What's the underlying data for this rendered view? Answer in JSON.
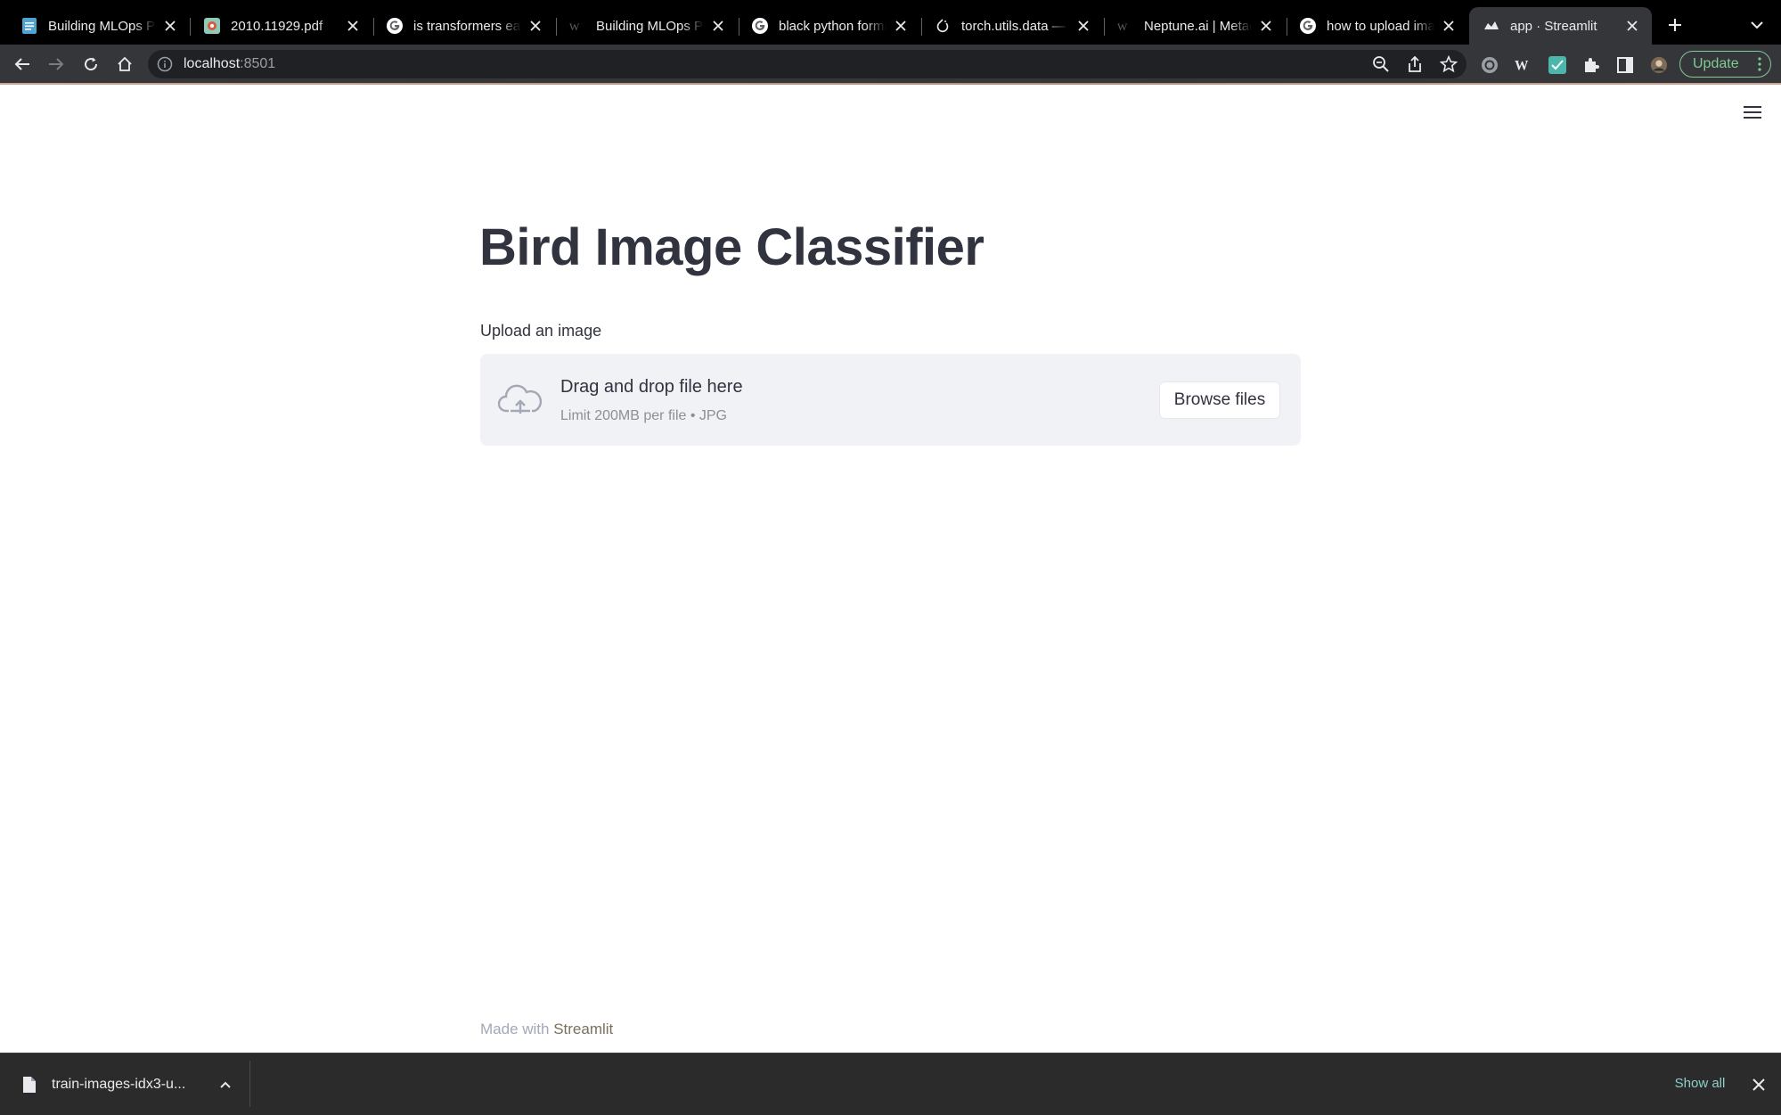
{
  "browser": {
    "tabs": [
      {
        "title": "Building MLOps Pipeline",
        "favicon": "docs-icon",
        "active": false
      },
      {
        "title": "2010.11929.pdf",
        "favicon": "pdf-icon",
        "active": false
      },
      {
        "title": "is transformers easy",
        "favicon": "google-icon",
        "active": false
      },
      {
        "title": "Building MLOps Pipeline",
        "favicon": "medium-icon",
        "active": false
      },
      {
        "title": "black python formatter",
        "favicon": "google-icon",
        "active": false
      },
      {
        "title": "torch.utils.data — PyTorch",
        "favicon": "pytorch-icon",
        "active": false
      },
      {
        "title": "Neptune.ai | Metadata",
        "favicon": "neptune-icon",
        "active": false
      },
      {
        "title": "how to upload image",
        "favicon": "google-icon",
        "active": false
      },
      {
        "title": "app · Streamlit",
        "favicon": "streamlit-icon",
        "active": true
      }
    ],
    "address": {
      "host": "localhost",
      "port": ":8501"
    },
    "update_label": "Update"
  },
  "page": {
    "title": "Bird Image Classifier",
    "uploader": {
      "label": "Upload an image",
      "drop_text": "Drag and drop file here",
      "limit_text": "Limit 200MB per file • JPG",
      "button": "Browse files"
    },
    "footer": {
      "prefix": "Made with ",
      "link": "Streamlit"
    }
  },
  "downloads": {
    "file": "train-images-idx3-u...",
    "show_all": "Show all"
  },
  "colors": {
    "text": "#31333f",
    "dropzone_bg": "#f0f2f6",
    "tabstrip_bg": "#000000",
    "toolbar_bg": "#35363a",
    "update_accent": "#81c995"
  }
}
